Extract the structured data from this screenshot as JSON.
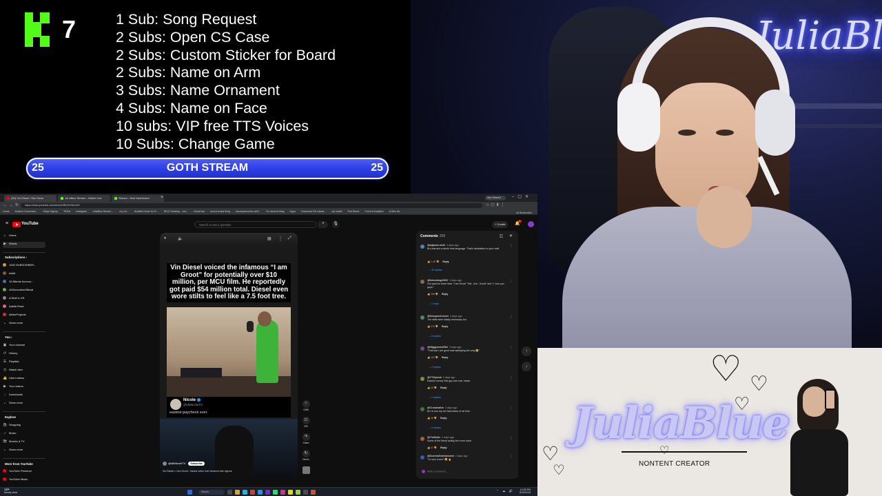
{
  "sub_goals": {
    "kick_count": "7",
    "items": [
      "1 Sub: Song Request",
      "2 Subs: Open CS Case",
      "2 Subs: Custom Sticker for Board",
      "2 Subs: Name on Arm",
      "3 Subs: Name Ornament",
      "4 Subs: Name on Face",
      "10 subs: VIP free TTS Voices",
      "10 Subs: Change Game"
    ],
    "goal_bar": {
      "left": "25",
      "title": "GOTH STREAM",
      "right": "25"
    }
  },
  "webcam": {
    "neon_sign": "JuliaBlue"
  },
  "browser": {
    "tabs": [
      {
        "label": "(99) Vin Diesel / Kim Dean",
        "color": "#ff0000"
      },
      {
        "label": "Jul eBlue Stream - Watch Live",
        "color": "#53fc18"
      },
      {
        "label": "Stream - Kick Dashboard",
        "color": "#53fc18"
      }
    ],
    "address": "https://www.youtube.com/shorts/9RzOKWmCM",
    "profile": "Ash Gerrard",
    "bookmarks": [
      "Home",
      "Kickbot Customiza...",
      "Stripe Signup",
      "TikTok",
      "Instagram",
      "JuliaBlue Stream ...",
      "my cla...",
      "Alcaltek Home for R...",
      "RKJC Desktop - ces...",
      "reload bar",
      "sound board thing",
      "ansmyaccounts.ca/H...",
      "Dn desired thing",
      "logos",
      "Download Die valuat...",
      "cfp mallet",
      "Rod Brace",
      "Current Analytics",
      "st files list"
    ],
    "all_bookmarks": "All Bookmarks",
    "youtube": {
      "wordmark": "YouTube",
      "search_placeholder": "Search or ask a question",
      "create_label": "+ Create",
      "bell_badge": "9+",
      "sidebar": {
        "top": [
          {
            "icon": "⌂",
            "label": "Home"
          },
          {
            "icon": "▶",
            "label": "Shorts"
          }
        ],
        "subscriptions_heading": "Subscriptions  ›",
        "subscriptions": [
          {
            "label": "1000 SUBSCRIBER...",
            "color": "#c9a227"
          },
          {
            "label": "dwild",
            "color": "#7a5c3a"
          },
          {
            "label": "10-Minute Accoun...",
            "color": "#4a6ea8"
          },
          {
            "label": "4000creativeOfficial",
            "color": "#6fa84a"
          },
          {
            "label": "A Wolf in VR",
            "color": "#8a8a8a"
          },
          {
            "label": "Adelia Rose",
            "color": "#d66a8a"
          },
          {
            "label": "AidenProjects",
            "color": "#c33"
          }
        ],
        "show_more_1": "Show more",
        "you_heading": "You  ›",
        "you_items": [
          {
            "icon": "▣",
            "label": "Your channel"
          },
          {
            "icon": "↺",
            "label": "History"
          },
          {
            "icon": "☰",
            "label": "Playlists"
          },
          {
            "icon": "◷",
            "label": "Watch later"
          },
          {
            "icon": "👍",
            "label": "Liked videos"
          },
          {
            "icon": "▶",
            "label": "Your videos"
          },
          {
            "icon": "↓",
            "label": "Downloads"
          }
        ],
        "show_more_2": "Show more",
        "explore_heading": "Explore",
        "explore_items": [
          {
            "icon": "🛍",
            "label": "Shopping"
          },
          {
            "icon": "♪",
            "label": "Music"
          },
          {
            "icon": "🎬",
            "label": "Movies & TV"
          }
        ],
        "show_more_3": "Show more",
        "more_heading": "More from YouTube",
        "more_items": [
          {
            "label": "YouTube Premium"
          },
          {
            "label": "YouTube Music"
          }
        ]
      },
      "short": {
        "caption": "Vin Diesel voiced the infamous “I am Groot” for potentially over $10 million, per MCU film. He reportedly got paid $54 million total. Diesel even wore stilts to feel like a 7.5 foot tree.",
        "tweet_name": "Nicole",
        "tweet_handle": "@idkNicoleTV",
        "tweet_text": "easiest paycheck ever.",
        "channel": "@idkNicoleTV",
        "subscribe": "Subscribe",
        "description": "Vin Diesel • I Am Groot • Insane voice over #marvel #vin #groot",
        "actions": [
          {
            "icon": "♡",
            "label": "105K"
          },
          {
            "icon": "☐",
            "label": "209"
          },
          {
            "icon": "↷",
            "label": "Share"
          },
          {
            "icon": "↻",
            "label": "Remix"
          }
        ]
      },
      "comments": {
        "title": "Comments",
        "count": "209",
        "items": [
          {
            "author": "@adjacent-sloth",
            "time": "4 days ago",
            "text": "Bro learned a whole new language. That's dedication to your craft",
            "likes": "1.4K",
            "color": "#5b7fb0",
            "replies": "33 replies"
          },
          {
            "author": "@thelonelogo5300",
            "time": "3 days ago",
            "text": "Got paid for three lines \"I am Groot\" \"We.. Are.. Groot\" and \"I, love you guys.\"",
            "likes": "268",
            "color": "#8a6a4a",
            "replies": "1 reply"
          },
          {
            "author": "@DesupersGunner",
            "time": "4 days ago",
            "text": "The stilts were totally necessary too",
            "likes": "276",
            "color": "#4a8a6a",
            "replies": "8 replies"
          },
          {
            "author": "@MiggyworksOffcl",
            "time": "3 days ago",
            "text": "\"That last I am groot was satisfying lols why 😂\"",
            "likes": "102",
            "color": "#6a4a8a",
            "replies": "2 replies"
          },
          {
            "author": "@YTOpenxb",
            "time": "3 days ago",
            "text": "Easiest money this guy has ever made.",
            "likes": "40",
            "color": "#8a8a3a",
            "replies": "2 replies"
          },
          {
            "author": "@Crowdnation",
            "time": "3 days ago",
            "text": "Bro in two top ten franchises of all time",
            "likes": "45",
            "color": "#3a7a3a",
            "replies": "5 replies"
          },
          {
            "author": "@TheRobin",
            "time": "2 days ago",
            "text": "Some of the finest acting he's ever done",
            "likes": "47",
            "color": "#aa5a3a",
            "replies": ""
          },
          {
            "author": "@DominikEntertainment",
            "time": "2 days ago",
            "text": "\"Yo sow creed\" 😆 🔥",
            "likes": "",
            "color": "#3a5aaa",
            "replies": ""
          }
        ],
        "add_placeholder": "Add a comment..."
      }
    },
    "taskbar": {
      "temp": "73°F",
      "weather": "Mostly clear",
      "search": "Search",
      "time": "10:36 PM",
      "date": "8/15/2024",
      "icon_colors": [
        "#2b6cd8",
        "#d8a42b",
        "#2bb0d8",
        "#d83a2b",
        "#4a4a4a",
        "#2bd86b",
        "#6b2bd8",
        "#d82b8e",
        "#2b8ed8",
        "#d8d82b",
        "#8ed82b",
        "#d84a2b"
      ]
    }
  },
  "brand_card": {
    "name": "JuliaBlue",
    "tagline": "NONTENT CREATOR"
  }
}
